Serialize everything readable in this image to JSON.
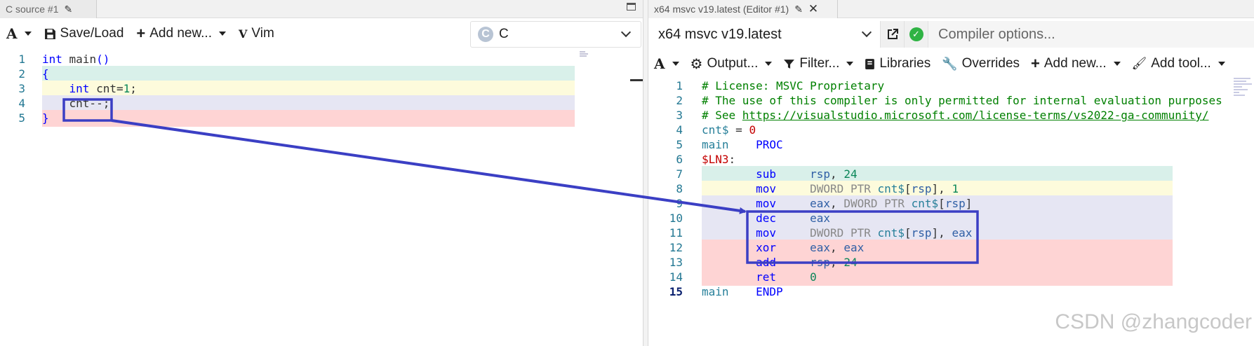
{
  "left": {
    "tab_title": "C source #1",
    "toolbar": {
      "font_menu": "A",
      "save_load": "Save/Load",
      "add_new": "Add new...",
      "vim": "Vim"
    },
    "language": "C",
    "code_lines": [
      {
        "n": "1",
        "hl": "",
        "parts": [
          [
            "kw",
            "int"
          ],
          [
            "dim",
            " main"
          ],
          [
            "kw",
            "()"
          ]
        ]
      },
      {
        "n": "2",
        "hl": "hl-0",
        "parts": [
          [
            "kw",
            "{"
          ]
        ]
      },
      {
        "n": "3",
        "hl": "hl-1",
        "parts": [
          [
            "dim",
            "    "
          ],
          [
            "kw",
            "int"
          ],
          [
            "dim",
            " cnt="
          ],
          [
            "num",
            "1"
          ],
          [
            "dim",
            ";"
          ]
        ]
      },
      {
        "n": "4",
        "hl": "hl-2",
        "parts": [
          [
            "dim",
            "    cnt--;"
          ]
        ]
      },
      {
        "n": "5",
        "hl": "hl-3",
        "parts": [
          [
            "kw",
            "}"
          ]
        ]
      }
    ]
  },
  "right": {
    "tab_title": "x64 msvc v19.latest (Editor #1)",
    "compiler": "x64 msvc v19.latest",
    "compiler_options_placeholder": "Compiler options...",
    "toolbar": {
      "font_menu": "A",
      "output": "Output...",
      "filter": "Filter...",
      "libraries": "Libraries",
      "overrides": "Overrides",
      "add_new": "Add new...",
      "add_tool": "Add tool..."
    },
    "asm_lines": [
      {
        "n": "1",
        "hl": "",
        "parts": [
          [
            "cm",
            "# License: MSVC Proprietary"
          ]
        ]
      },
      {
        "n": "2",
        "hl": "",
        "parts": [
          [
            "cm",
            "# The use of this compiler is only permitted for internal evaluation purposes"
          ]
        ]
      },
      {
        "n": "3",
        "hl": "",
        "parts": [
          [
            "cm",
            "# See "
          ],
          [
            "lnk",
            "https://visualstudio.microsoft.com/license-terms/vs2022-ga-community/"
          ]
        ]
      },
      {
        "n": "4",
        "hl": "",
        "parts": [
          [
            "sym",
            "cnt$"
          ],
          [
            "dim",
            " = "
          ],
          [
            "lbl",
            "0"
          ]
        ]
      },
      {
        "n": "5",
        "hl": "",
        "parts": [
          [
            "sym",
            "main"
          ],
          [
            "dim",
            "    "
          ],
          [
            "inst",
            "PROC"
          ]
        ]
      },
      {
        "n": "6",
        "hl": "",
        "parts": [
          [
            "lbl",
            "$LN3"
          ],
          [
            "dim",
            ":"
          ]
        ]
      },
      {
        "n": "7",
        "hl": "hl-0",
        "parts": [
          [
            "dim",
            "        "
          ],
          [
            "inst",
            "sub"
          ],
          [
            "dim",
            "     "
          ],
          [
            "reg",
            "rsp"
          ],
          [
            "dim",
            ", "
          ],
          [
            "num",
            "24"
          ]
        ]
      },
      {
        "n": "8",
        "hl": "hl-1",
        "parts": [
          [
            "dim",
            "        "
          ],
          [
            "inst",
            "mov"
          ],
          [
            "dim",
            "     "
          ],
          [
            "ptr",
            "DWORD PTR "
          ],
          [
            "sym",
            "cnt$"
          ],
          [
            "dim",
            "["
          ],
          [
            "reg",
            "rsp"
          ],
          [
            "dim",
            "], "
          ],
          [
            "num",
            "1"
          ]
        ]
      },
      {
        "n": "9",
        "hl": "hl-2",
        "parts": [
          [
            "dim",
            "        "
          ],
          [
            "inst",
            "mov"
          ],
          [
            "dim",
            "     "
          ],
          [
            "reg",
            "eax"
          ],
          [
            "dim",
            ", "
          ],
          [
            "ptr",
            "DWORD PTR "
          ],
          [
            "sym",
            "cnt$"
          ],
          [
            "dim",
            "["
          ],
          [
            "reg",
            "rsp"
          ],
          [
            "dim",
            "]"
          ]
        ]
      },
      {
        "n": "10",
        "hl": "hl-2",
        "parts": [
          [
            "dim",
            "        "
          ],
          [
            "inst",
            "dec"
          ],
          [
            "dim",
            "     "
          ],
          [
            "reg",
            "eax"
          ]
        ]
      },
      {
        "n": "11",
        "hl": "hl-2",
        "parts": [
          [
            "dim",
            "        "
          ],
          [
            "inst",
            "mov"
          ],
          [
            "dim",
            "     "
          ],
          [
            "ptr",
            "DWORD PTR "
          ],
          [
            "sym",
            "cnt$"
          ],
          [
            "dim",
            "["
          ],
          [
            "reg",
            "rsp"
          ],
          [
            "dim",
            "], "
          ],
          [
            "reg",
            "eax"
          ]
        ]
      },
      {
        "n": "12",
        "hl": "hl-3",
        "parts": [
          [
            "dim",
            "        "
          ],
          [
            "inst",
            "xor"
          ],
          [
            "dim",
            "     "
          ],
          [
            "reg",
            "eax"
          ],
          [
            "dim",
            ", "
          ],
          [
            "reg",
            "eax"
          ]
        ]
      },
      {
        "n": "13",
        "hl": "hl-3",
        "parts": [
          [
            "dim",
            "        "
          ],
          [
            "inst",
            "add"
          ],
          [
            "dim",
            "     "
          ],
          [
            "reg",
            "rsp"
          ],
          [
            "dim",
            ", "
          ],
          [
            "num",
            "24"
          ]
        ]
      },
      {
        "n": "14",
        "hl": "hl-3",
        "parts": [
          [
            "dim",
            "        "
          ],
          [
            "inst",
            "ret"
          ],
          [
            "dim",
            "     "
          ],
          [
            "num",
            "0"
          ]
        ]
      },
      {
        "n": "15",
        "hl": "",
        "parts": [
          [
            "sym",
            "main"
          ],
          [
            "dim",
            "    "
          ],
          [
            "inst",
            "ENDP"
          ]
        ]
      }
    ]
  },
  "watermark": "CSDN @zhangcoder",
  "colors": {
    "annotation": "#3b3fc4",
    "hl_teal": "#d9f0ea",
    "hl_yellow": "#fdfbdc",
    "hl_lavender": "#e6e6f3",
    "hl_pink": "#fed4d4",
    "ok_green": "#2fb344"
  }
}
